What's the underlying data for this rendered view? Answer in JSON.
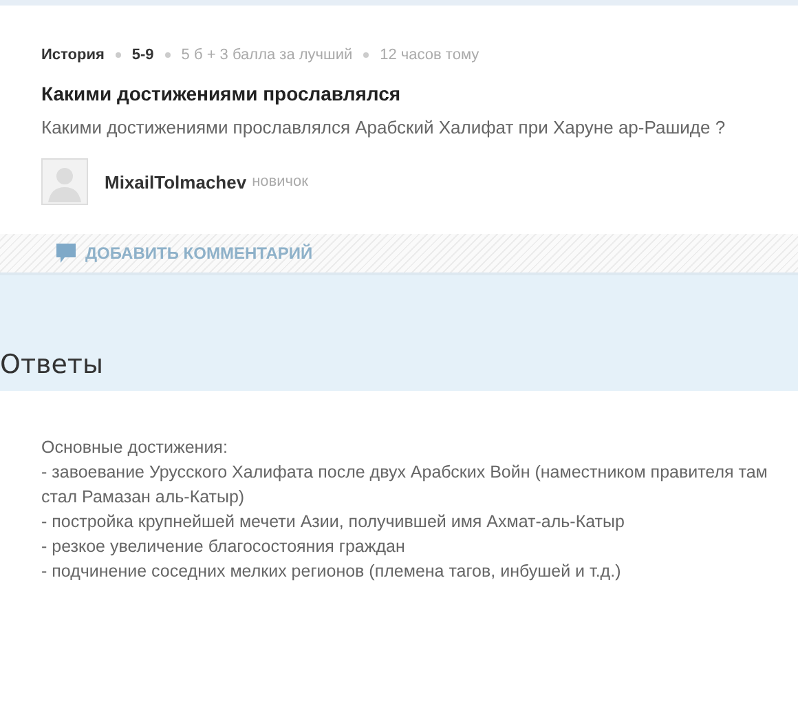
{
  "question": {
    "meta": [
      {
        "text": "История",
        "kind": "strong"
      },
      {
        "text": "5-9",
        "kind": "strong"
      },
      {
        "text": "5 б + 3 балла за лучший",
        "kind": "muted"
      },
      {
        "text": "12 часов тому",
        "kind": "muted"
      }
    ],
    "title": "Какими достижениями прославлялся",
    "text": "Какими достижениями прославлялся Арабский Халифат при Харуне ар-Рашиде ?",
    "author": {
      "name": "MixailTolmachev",
      "rank": "новичок"
    }
  },
  "comment_button": "ДОБАВИТЬ КОММЕНТАРИЙ",
  "answers_heading": "Ответы",
  "answer": {
    "lines": [
      "Основные достижения:",
      "- завоевание Урусского Халифата после двух Арабских Войн (наместником правителя там стал Рамазан аль-Катыр)",
      "- постройка крупнейшей мечети Азии, получившей имя Ахмат-аль-Катыр",
      "- резкое увеличение благосостояния граждан",
      "- подчинение соседних мелких регионов (племена тагов, инбушей и т.д.)"
    ]
  }
}
